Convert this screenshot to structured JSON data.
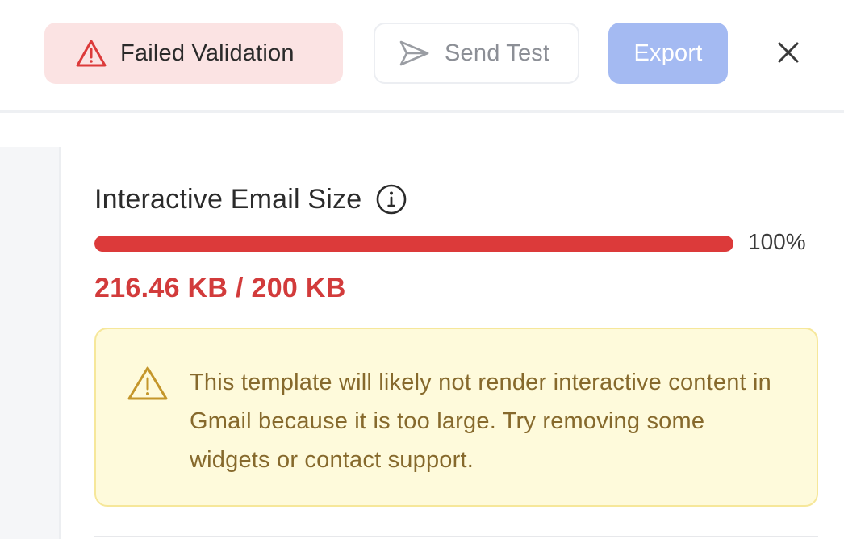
{
  "toolbar": {
    "failed_label": "Failed Validation",
    "failed_icon": "warning-triangle-icon",
    "send_test_label": "Send Test",
    "send_test_icon": "paper-plane-icon",
    "export_label": "Export",
    "close_icon": "close-icon"
  },
  "size_panel": {
    "title": "Interactive Email Size",
    "info_icon": "info-icon",
    "progress_percent_label": "100%",
    "progress_fraction": 1.0,
    "size_text": "216.46 KB / 200 KB",
    "warning_icon": "warning-triangle-icon",
    "warning_message": "This template will likely not render interactive content in Gmail because it is too large. Try removing some widgets or contact support."
  },
  "colors": {
    "error_red": "#dc3a3a",
    "failed_pill_bg": "#fbe3e3",
    "export_bg": "#a4baf2",
    "warning_bg": "#fefadb",
    "warning_border": "#f6e79a",
    "warning_text": "#86692c"
  }
}
